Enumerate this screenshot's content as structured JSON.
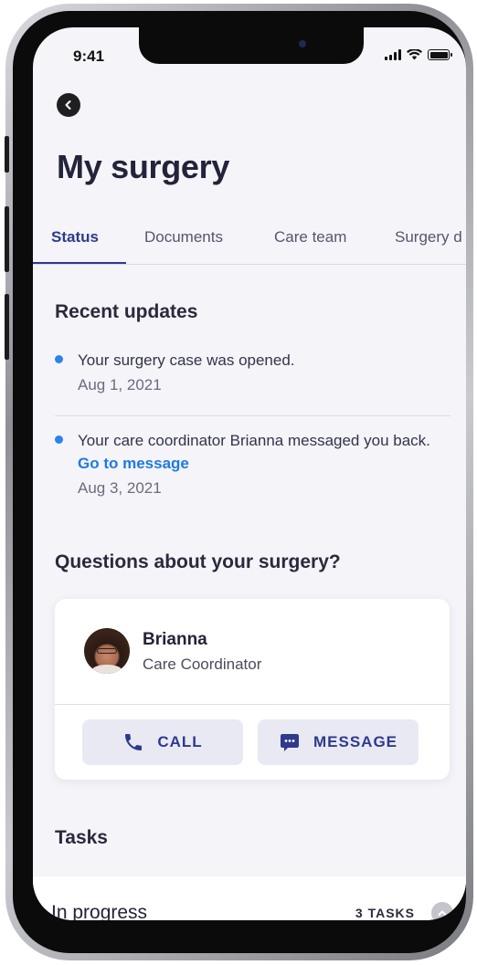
{
  "status_bar": {
    "time": "9:41"
  },
  "header": {
    "title": "My surgery"
  },
  "tabs": [
    {
      "label": "Status",
      "active": true
    },
    {
      "label": "Documents",
      "active": false
    },
    {
      "label": "Care team",
      "active": false
    },
    {
      "label": "Surgery d",
      "active": false
    }
  ],
  "recent_updates": {
    "title": "Recent updates",
    "items": [
      {
        "text": "Your surgery case was opened.",
        "link": "",
        "date": "Aug 1, 2021"
      },
      {
        "text": "Your care coordinator Brianna messaged you back.",
        "link": "Go to message",
        "date": "Aug 3, 2021"
      }
    ]
  },
  "questions": {
    "title": "Questions about your surgery?",
    "contact": {
      "name": "Brianna",
      "role": "Care Coordinator"
    },
    "call_label": "CALL",
    "message_label": "MESSAGE"
  },
  "tasks": {
    "title": "Tasks",
    "group_label": "In progress",
    "count_label": "3 TASKS"
  },
  "colors": {
    "accent": "#2e3a8c",
    "link": "#1f7ae0",
    "dot": "#2f80ed",
    "background": "#f4f4f9"
  },
  "icons": [
    "back-arrow-icon",
    "signal-icon",
    "wifi-icon",
    "battery-icon",
    "phone-icon",
    "message-bubble-icon",
    "chevron-up-icon"
  ]
}
